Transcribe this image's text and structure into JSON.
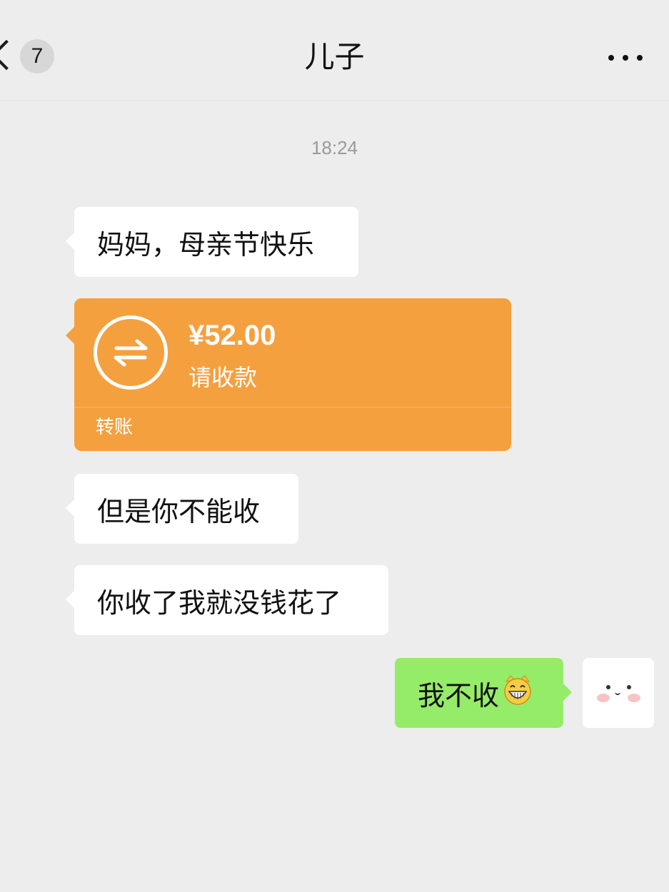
{
  "header": {
    "back_count": "7",
    "title": "儿子",
    "more_icon": "more-dots-icon"
  },
  "chat": {
    "time": "18:24",
    "messages_in": [
      "妈妈，母亲节快乐",
      "但是你不能收",
      "你收了我就没钱花了"
    ],
    "transfer": {
      "amount": "¥52.00",
      "status": "请收款",
      "label": "转账",
      "color": "#f5a03f",
      "icon": "transfer-arrows-icon"
    },
    "message_out": "我不收"
  },
  "colors": {
    "background": "#ededed",
    "incoming_bubble": "#ffffff",
    "outgoing_bubble": "#95ec69"
  }
}
